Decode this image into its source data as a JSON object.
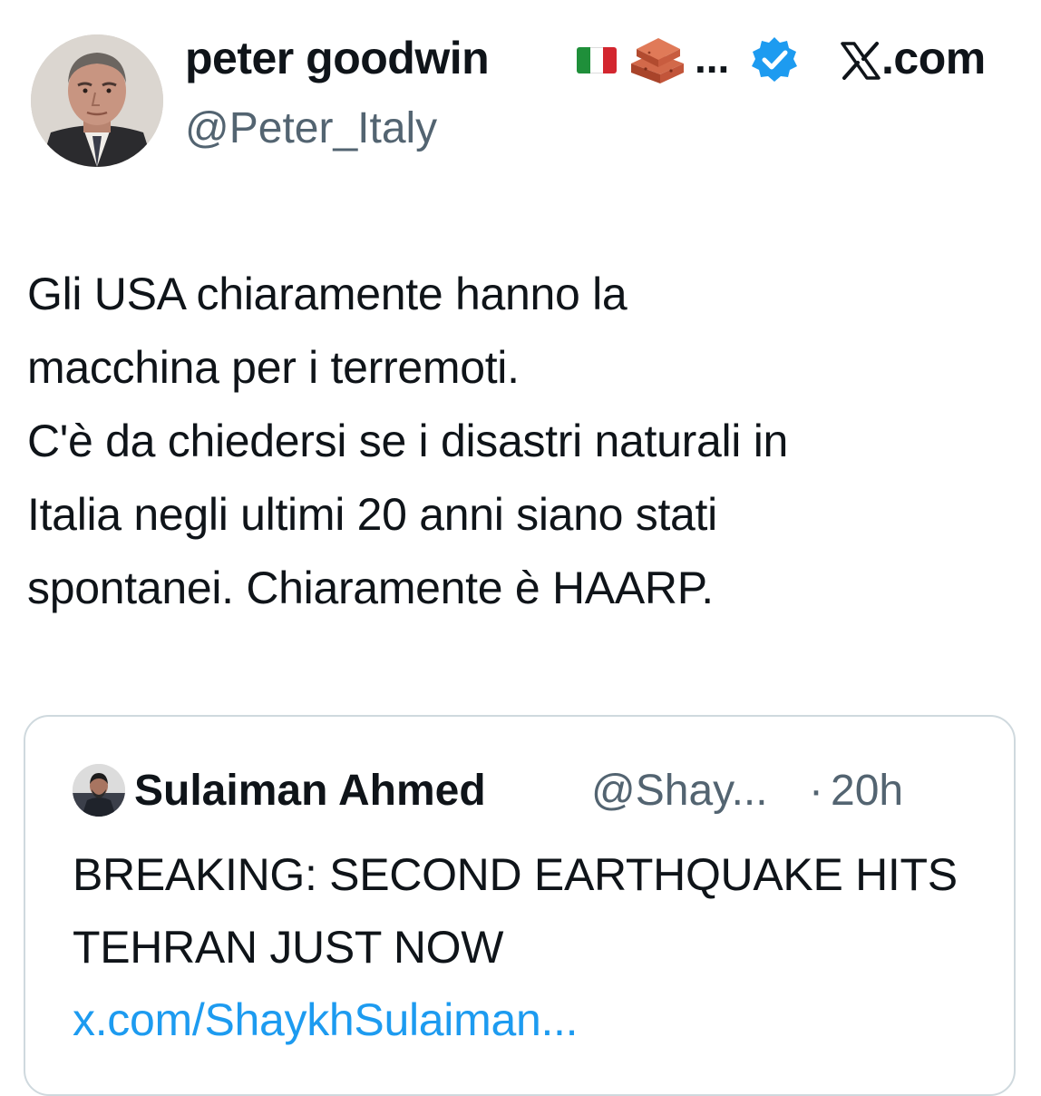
{
  "author": {
    "display_name": "peter goodwin",
    "name_ellipsis": "...",
    "handle": "@Peter_Italy",
    "avatar_icon": "person-portrait",
    "flag_colors": [
      "#1f8f3a",
      "#ffffff",
      "#d3262f"
    ],
    "verified_color": "#1d9bf0"
  },
  "site": {
    "logo": "x-logo",
    "label": ".com"
  },
  "tweet": {
    "text": "Gli USA chiaramente hanno la\nmacchina per i terremoti.\nC'è da chiedersi se i disastri naturali in\nItalia negli ultimi 20 anni siano stati\nspontanei. Chiaramente è HAARP."
  },
  "quoted_tweet": {
    "display_name": "Sulaiman Ahmed",
    "handle": "@Shay...",
    "separator": "·",
    "time": "20h",
    "text": "BREAKING: SECOND EARTHQUAKE HITS TEHRAN JUST NOW ",
    "link": "x.com/ShaykhSulaiman...",
    "link_color": "#1d9bf0"
  }
}
